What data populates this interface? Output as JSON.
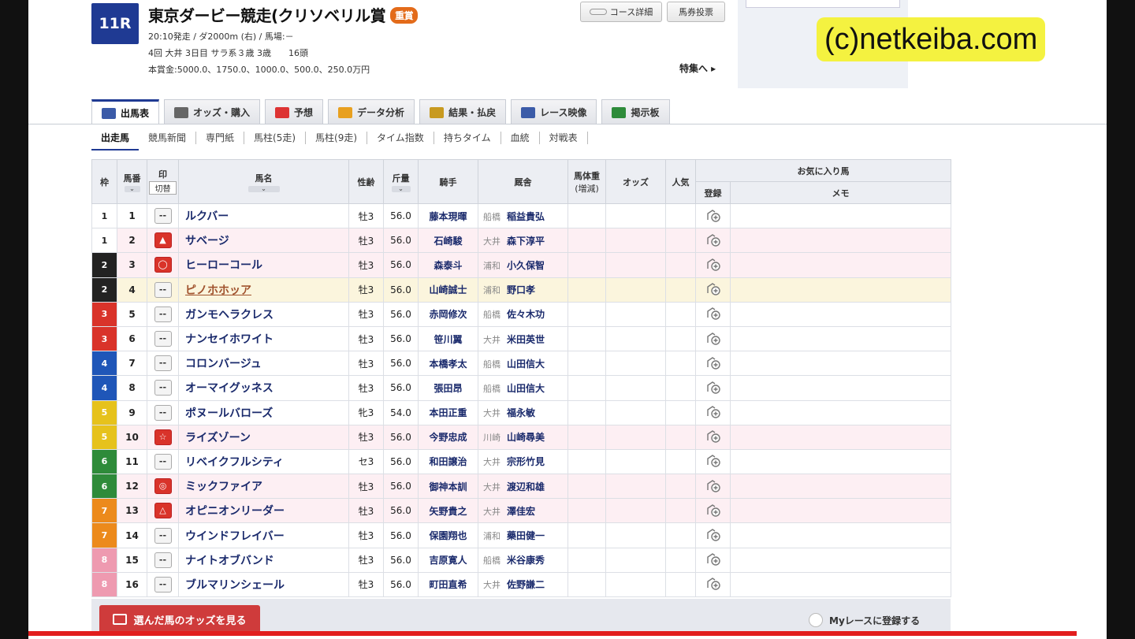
{
  "race": {
    "number": "11R",
    "title": "東京ダービー競走(クリソベリル賞",
    "grade": "重賞",
    "line1": "20:10発走 / ダ2000m (右) / 馬場:－",
    "line2": "4回 大井 3日目 サラ系３歳 3歳　　16頭",
    "line3": "本賞金:5000.0、1750.0、1000.0、500.0、250.0万円"
  },
  "top_buttons": {
    "course": "コース詳細",
    "ticket": "馬券投票"
  },
  "feature_link": "特集へ ▸",
  "watermark": "(c)netkeiba.com",
  "tabs": [
    {
      "label": "出馬表",
      "color": "#3b5ba8"
    },
    {
      "label": "オッズ・購入",
      "color": "#666"
    },
    {
      "label": "予想",
      "color": "#d33"
    },
    {
      "label": "データ分析",
      "color": "#e8a020"
    },
    {
      "label": "結果・払戻",
      "color": "#c89a20"
    },
    {
      "label": "レース映像",
      "color": "#3b5ba8"
    },
    {
      "label": "掲示板",
      "color": "#2e8b3a"
    }
  ],
  "sub_tabs": [
    "出走馬",
    "競馬新聞",
    "専門紙",
    "馬柱(5走)",
    "馬柱(9走)",
    "タイム指数",
    "持ちタイム",
    "血統",
    "対戦表"
  ],
  "headers": {
    "waku": "枠",
    "umaban": "馬番",
    "mark": "印",
    "mark_sub": "切替",
    "horse": "馬名",
    "sex": "性齢",
    "weight": "斤量",
    "jockey": "騎手",
    "trainer": "厩舎",
    "bodyweight": "馬体重",
    "bodyweight_sub": "(増減)",
    "odds": "オッズ",
    "pop": "人気",
    "fav": "お気に入り馬",
    "reg": "登録",
    "memo": "メモ"
  },
  "waku_colors": {
    "1": {
      "bg": "#ffffff",
      "fg": "#222"
    },
    "2": {
      "bg": "#222222",
      "fg": "#fff"
    },
    "3": {
      "bg": "#d9332a",
      "fg": "#fff"
    },
    "4": {
      "bg": "#1f56b8",
      "fg": "#fff"
    },
    "5": {
      "bg": "#e6c21c",
      "fg": "#fff"
    },
    "6": {
      "bg": "#2e8b3a",
      "fg": "#fff"
    },
    "7": {
      "bg": "#ec8a1c",
      "fg": "#fff"
    },
    "8": {
      "bg": "#ee9ab0",
      "fg": "#fff"
    }
  },
  "rows": [
    {
      "waku": "1",
      "umaban": "1",
      "mark": "--",
      "horse": "ルクバー",
      "sex": "牡3",
      "weight": "56.0",
      "jockey": "藤本現暉",
      "area": "船橋",
      "trainer": "稲益貴弘",
      "hl": false
    },
    {
      "waku": "1",
      "umaban": "2",
      "mark": "▲",
      "horse": "サベージ",
      "sex": "牡3",
      "weight": "56.0",
      "jockey": "石崎駿",
      "area": "大井",
      "trainer": "森下淳平",
      "hl": true
    },
    {
      "waku": "2",
      "umaban": "3",
      "mark": "◯",
      "horse": "ヒーローコール",
      "sex": "牡3",
      "weight": "56.0",
      "jockey": "森泰斗",
      "area": "浦和",
      "trainer": "小久保智",
      "hl": true
    },
    {
      "waku": "2",
      "umaban": "4",
      "mark": "--",
      "horse": "ピノホホッア",
      "sex": "牡3",
      "weight": "56.0",
      "jockey": "山崎誠士",
      "area": "浦和",
      "trainer": "野口孝",
      "yl": true
    },
    {
      "waku": "3",
      "umaban": "5",
      "mark": "--",
      "horse": "ガンモヘラクレス",
      "sex": "牡3",
      "weight": "56.0",
      "jockey": "赤岡修次",
      "area": "船橋",
      "trainer": "佐々木功",
      "hl": false
    },
    {
      "waku": "3",
      "umaban": "6",
      "mark": "--",
      "horse": "ナンセイホワイト",
      "sex": "牡3",
      "weight": "56.0",
      "jockey": "笹川翼",
      "area": "大井",
      "trainer": "米田英世",
      "hl": false
    },
    {
      "waku": "4",
      "umaban": "7",
      "mark": "--",
      "horse": "コロンバージュ",
      "sex": "牡3",
      "weight": "56.0",
      "jockey": "本橋孝太",
      "area": "船橋",
      "trainer": "山田信大",
      "hl": false
    },
    {
      "waku": "4",
      "umaban": "8",
      "mark": "--",
      "horse": "オーマイグッネス",
      "sex": "牡3",
      "weight": "56.0",
      "jockey": "張田昂",
      "area": "船橋",
      "trainer": "山田信大",
      "hl": false
    },
    {
      "waku": "5",
      "umaban": "9",
      "mark": "--",
      "horse": "ポヌールバローズ",
      "sex": "牝3",
      "weight": "54.0",
      "jockey": "本田正重",
      "area": "大井",
      "trainer": "福永敏",
      "hl": false
    },
    {
      "waku": "5",
      "umaban": "10",
      "mark": "☆",
      "horse": "ライズゾーン",
      "sex": "牡3",
      "weight": "56.0",
      "jockey": "今野忠成",
      "area": "川崎",
      "trainer": "山崎尋美",
      "hl": true
    },
    {
      "waku": "6",
      "umaban": "11",
      "mark": "--",
      "horse": "リベイクフルシティ",
      "sex": "セ3",
      "weight": "56.0",
      "jockey": "和田譲治",
      "area": "大井",
      "trainer": "宗形竹見",
      "hl": false
    },
    {
      "waku": "6",
      "umaban": "12",
      "mark": "◎",
      "horse": "ミックファイア",
      "sex": "牡3",
      "weight": "56.0",
      "jockey": "御神本訓",
      "area": "大井",
      "trainer": "渡辺和雄",
      "hl": true
    },
    {
      "waku": "7",
      "umaban": "13",
      "mark": "△",
      "horse": "オピニオンリーダー",
      "sex": "牡3",
      "weight": "56.0",
      "jockey": "矢野貴之",
      "area": "大井",
      "trainer": "澤佳宏",
      "hl": true
    },
    {
      "waku": "7",
      "umaban": "14",
      "mark": "--",
      "horse": "ウインドフレイバー",
      "sex": "牡3",
      "weight": "56.0",
      "jockey": "保園翔也",
      "area": "浦和",
      "trainer": "藥田健一",
      "hl": false
    },
    {
      "waku": "8",
      "umaban": "15",
      "mark": "--",
      "horse": "ナイトオブバンド",
      "sex": "牡3",
      "weight": "56.0",
      "jockey": "吉原寛人",
      "area": "船橋",
      "trainer": "米谷康秀",
      "hl": false
    },
    {
      "waku": "8",
      "umaban": "16",
      "mark": "--",
      "horse": "ブルマリンシェール",
      "sex": "牡3",
      "weight": "56.0",
      "jockey": "町田直希",
      "area": "大井",
      "trainer": "佐野謙二",
      "hl": false
    }
  ],
  "footer": {
    "odds_button": "選んだ馬のオッズを見る",
    "my_race": "Myレースに登録する"
  }
}
